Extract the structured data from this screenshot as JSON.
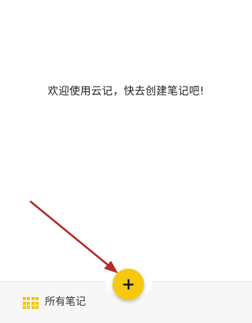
{
  "main": {
    "empty_message": "欢迎使用云记，快去创建笔记吧!"
  },
  "fab": {
    "icon": "plus-icon",
    "color": "#f6c90e"
  },
  "bottom_bar": {
    "menu_icon": "grid-icon",
    "all_notes_label": "所有笔记",
    "accent_color": "#f2c500"
  },
  "annotation": {
    "arrow_color": "#b52a2a"
  }
}
